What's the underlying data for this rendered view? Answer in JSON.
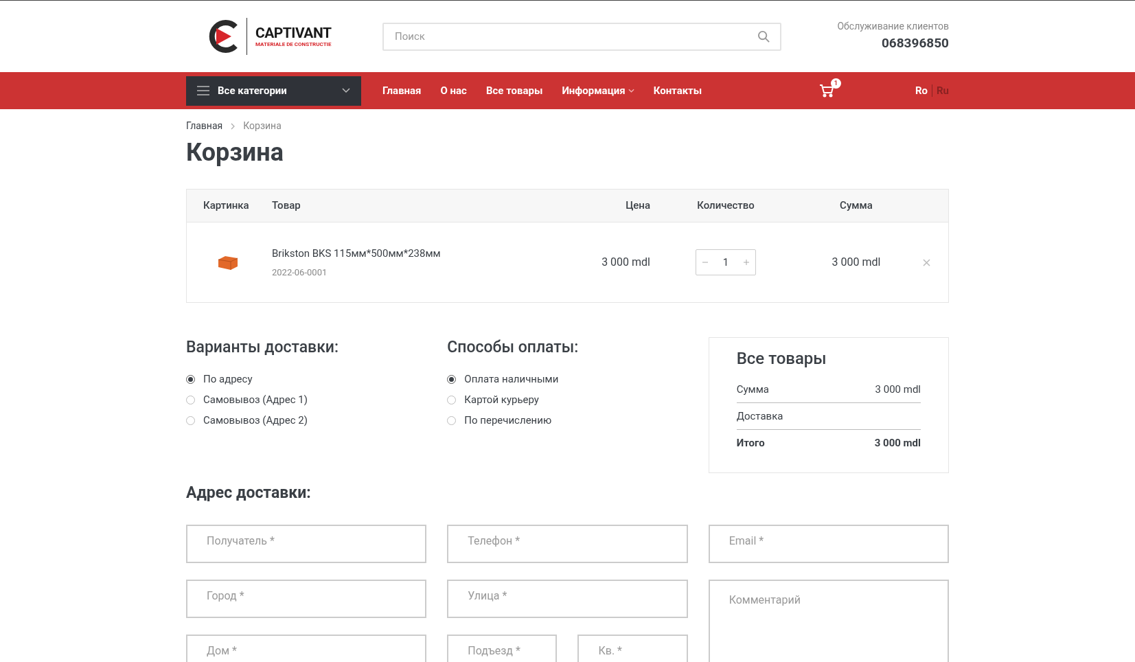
{
  "header": {
    "logo": {
      "name": "CAPTIVANT",
      "tagline": "MATERIALE DE CONSTRUCTIE"
    },
    "search": {
      "placeholder": "Поиск"
    },
    "support": {
      "label": "Обслуживание клиентов",
      "phone": "068396850"
    }
  },
  "nav": {
    "categories": "Все категории",
    "links": [
      {
        "label": "Главная",
        "dropdown": false
      },
      {
        "label": "О нас",
        "dropdown": false
      },
      {
        "label": "Все товары",
        "dropdown": false
      },
      {
        "label": "Информация",
        "dropdown": true
      },
      {
        "label": "Контакты",
        "dropdown": false
      }
    ],
    "cart_count": "1",
    "languages": [
      {
        "label": "Ro",
        "selected": true
      },
      {
        "label": "Ru",
        "selected": false
      }
    ]
  },
  "breadcrumb": [
    "Главная",
    "Корзина"
  ],
  "title": "Корзина",
  "cart": {
    "columns": [
      "Картинка",
      "Товар",
      "Цена",
      "Количество",
      "Сумма"
    ],
    "rows": [
      {
        "name": "Brikston BKS 115мм*500мм*238мм",
        "sku": "2022-06-0001",
        "price": "3 000 mdl",
        "quantity": "1",
        "sum": "3 000 mdl"
      }
    ]
  },
  "delivery": {
    "title": "Варианты доставки:",
    "options": [
      {
        "label": "По адресу",
        "selected": true
      },
      {
        "label": "Самовывоз (Адрес 1)",
        "selected": false
      },
      {
        "label": "Самовывоз (Адрес 2)",
        "selected": false
      }
    ]
  },
  "payment": {
    "title": "Способы оплаты:",
    "options": [
      {
        "label": "Оплата наличными",
        "selected": true
      },
      {
        "label": "Картой курьеру",
        "selected": false
      },
      {
        "label": "По перечислению",
        "selected": false
      }
    ]
  },
  "summary": {
    "title": "Все товары",
    "rows": [
      {
        "label": "Сумма",
        "value": "3 000 mdl",
        "bold": false
      },
      {
        "label": "Доставка",
        "bold": false
      },
      {
        "label": "Итого",
        "value": "3 000 mdl",
        "bold": true
      }
    ]
  },
  "address": {
    "title": "Адрес доставки:",
    "fields": [
      {
        "placeholder": "Получатель *"
      },
      {
        "placeholder": "Телефон *"
      },
      {
        "placeholder": "Email *"
      },
      {
        "placeholder": "Город *"
      },
      {
        "placeholder": "Улица *"
      },
      {
        "placeholder": "Комментарий",
        "kind": "textarea"
      },
      {
        "placeholder": "Дом *"
      },
      {
        "placeholder": "Подъезд *",
        "kind": "half"
      },
      {
        "placeholder": "Кв. *",
        "kind": "half"
      }
    ]
  }
}
